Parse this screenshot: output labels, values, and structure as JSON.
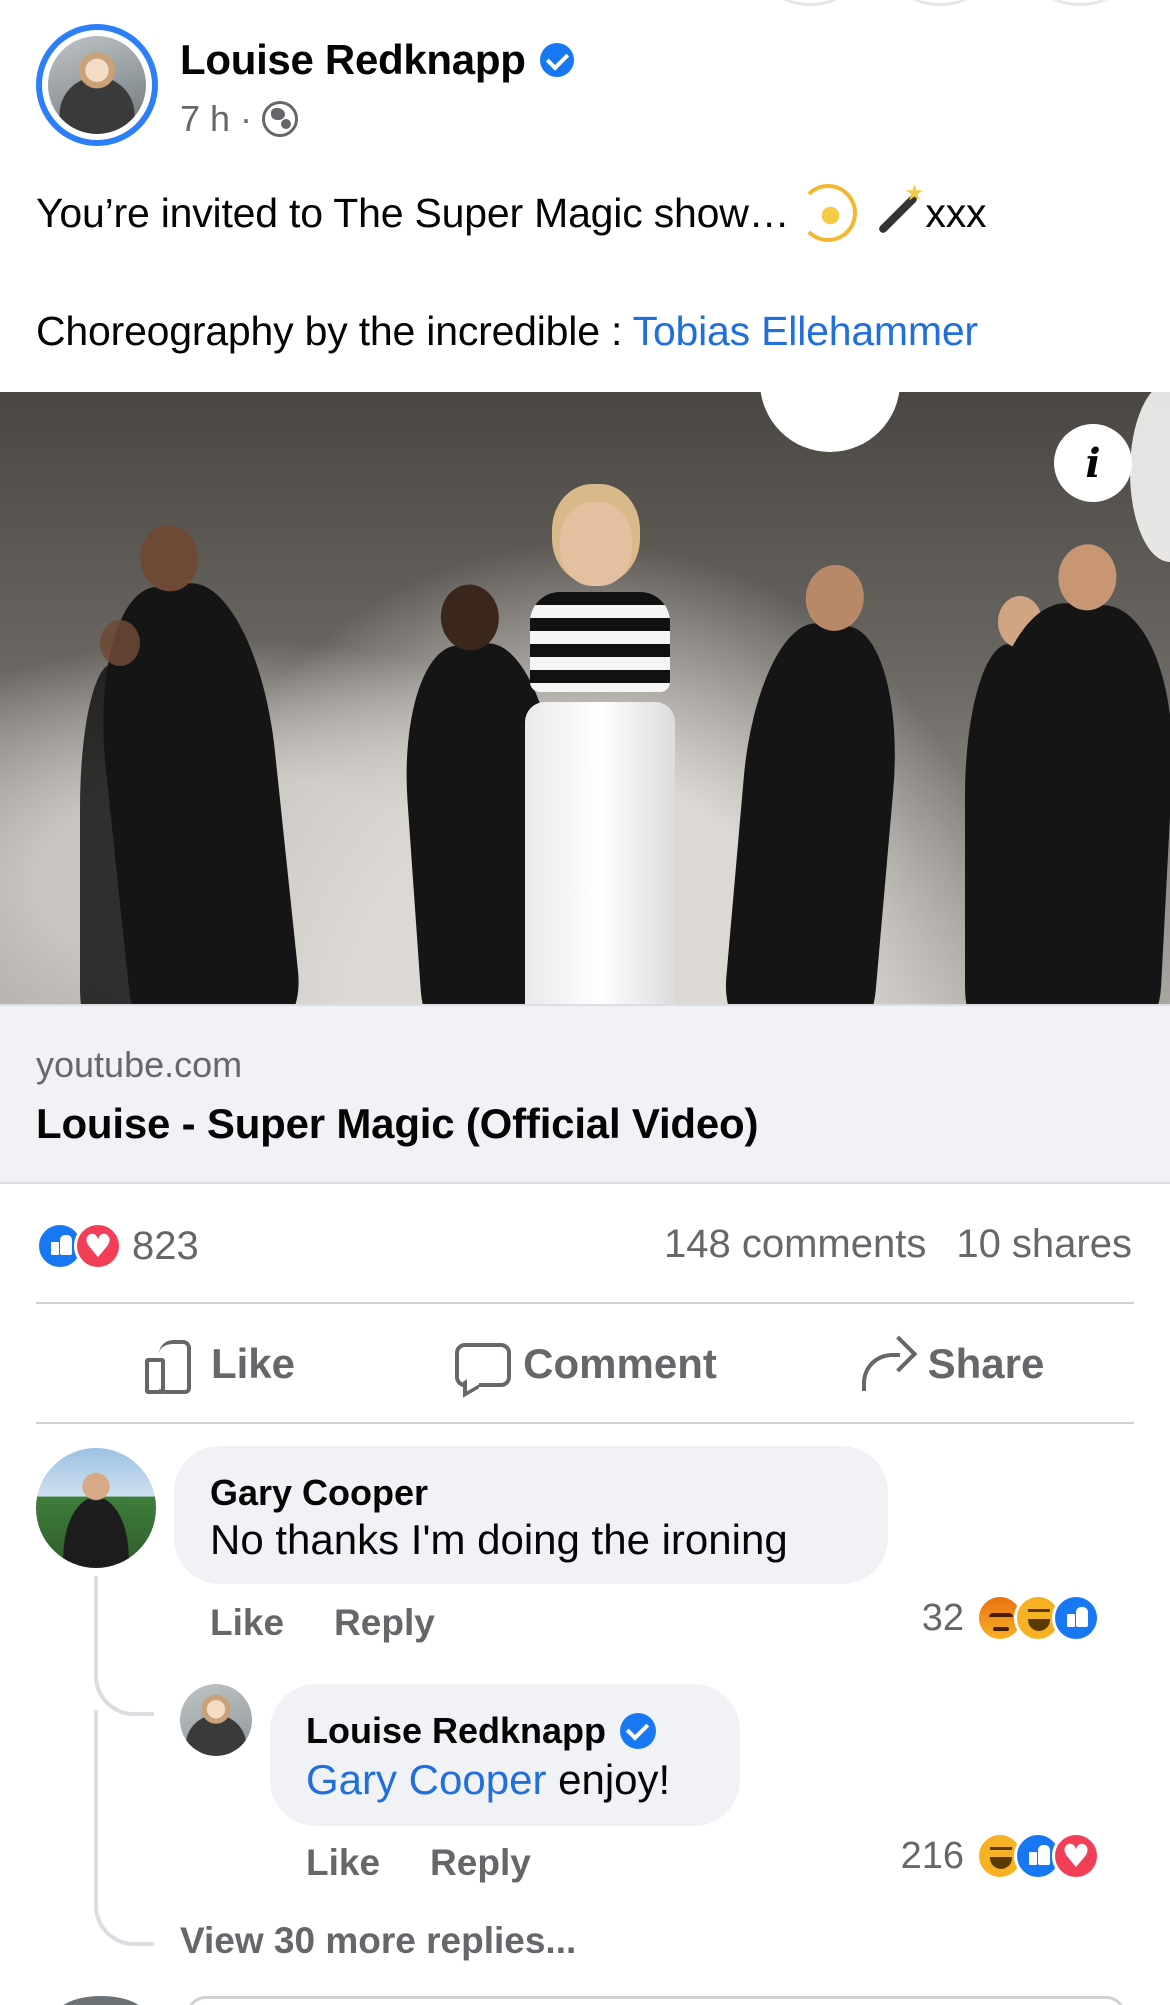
{
  "post": {
    "author": "Louise Redknapp",
    "time": "7 h",
    "separator": "·",
    "line1": "You’re invited to The Super Magic show…",
    "line1_suffix": "xxx",
    "line2_prefix": "Choreography by the incredible : ",
    "line2_link": "Tobias Ellehammer",
    "emojis": [
      "dizzy-icon",
      "wand-icon"
    ]
  },
  "link_preview": {
    "domain": "youtube.com",
    "title": "Louise - Super Magic (Official Video)",
    "info_label": "i"
  },
  "stats": {
    "reactions": [
      "like",
      "love"
    ],
    "reaction_count": "823",
    "comments": "148 comments",
    "shares": "10 shares"
  },
  "actions": {
    "like": "Like",
    "comment": "Comment",
    "share": "Share"
  },
  "comments": [
    {
      "author": "Gary Cooper",
      "text": "No thanks I'm doing the ironing",
      "like": "Like",
      "reply": "Reply",
      "reaction_count": "32",
      "reactions": [
        "angry",
        "haha",
        "like"
      ]
    },
    {
      "author": "Louise Redknapp",
      "mention": "Gary Cooper",
      "text": " enjoy!",
      "like": "Like",
      "reply": "Reply",
      "reaction_count": "216",
      "reactions": [
        "haha",
        "like",
        "love"
      ]
    }
  ],
  "view_more": "View 30 more replies...",
  "colors": {
    "accent": "#1877f2",
    "link": "#216fdb",
    "secondary_text": "#65676b",
    "bubble": "#f0f2f5"
  }
}
